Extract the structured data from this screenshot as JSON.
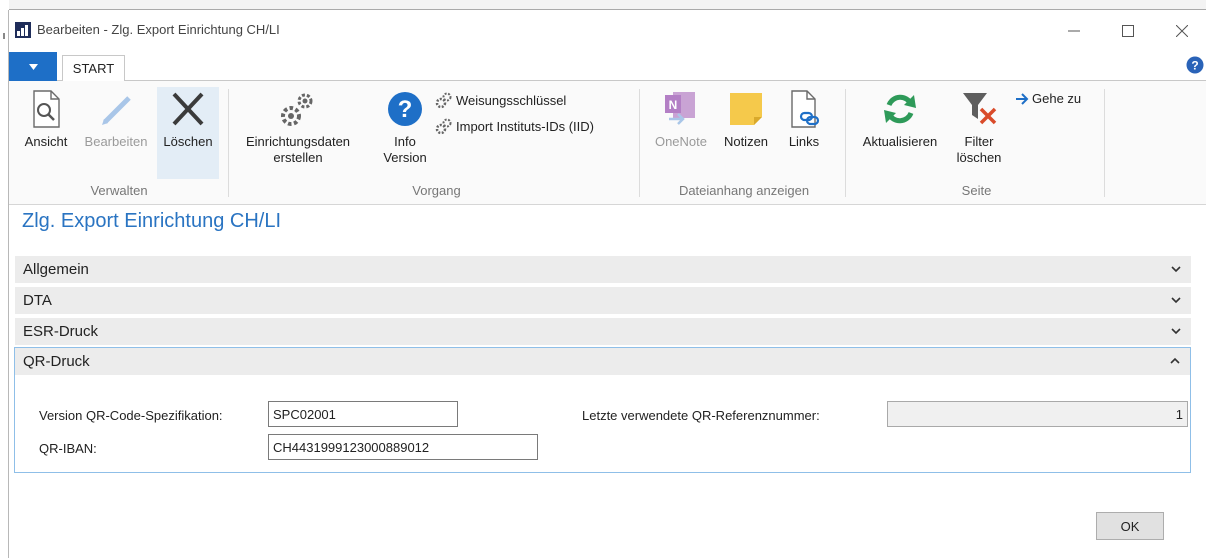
{
  "window": {
    "title": "Bearbeiten - Zlg. Export Einrichtung CH/LI"
  },
  "tabs": {
    "start_label": "START"
  },
  "ribbon": {
    "groups": {
      "verwalten": "Verwalten",
      "vorgang": "Vorgang",
      "dateianhang": "Dateianhang anzeigen",
      "seite": "Seite"
    },
    "buttons": {
      "ansicht": "Ansicht",
      "bearbeiten": "Bearbeiten",
      "loeschen": "Löschen",
      "einrichtungsdaten_line1": "Einrichtungsdaten",
      "einrichtungsdaten_line2": "erstellen",
      "info_line1": "Info",
      "info_line2": "Version",
      "weisungsschluessel": "Weisungsschlüssel",
      "import_iid": "Import Instituts-IDs (IID)",
      "onenote": "OneNote",
      "notizen": "Notizen",
      "links": "Links",
      "aktualisieren": "Aktualisieren",
      "filter_line1": "Filter",
      "filter_line2": "löschen",
      "gehe_zu": "Gehe zu"
    }
  },
  "page": {
    "title": "Zlg. Export Einrichtung CH/LI",
    "sections": [
      "Allgemein",
      "DTA",
      "ESR-Druck",
      "QR-Druck"
    ]
  },
  "qr": {
    "version_label": "Version QR-Code-Spezifikation:",
    "version_value": "SPC02001",
    "iban_label": "QR-IBAN:",
    "iban_value": "CH4431999123000889012",
    "letzte_label": "Letzte verwendete QR-Referenznummer:",
    "letzte_value": "1"
  },
  "footer": {
    "ok_label": "OK"
  },
  "colors": {
    "accent": "#1e6fc7",
    "title_blue": "#2a74c2",
    "panel_border": "#8fbfe8"
  }
}
